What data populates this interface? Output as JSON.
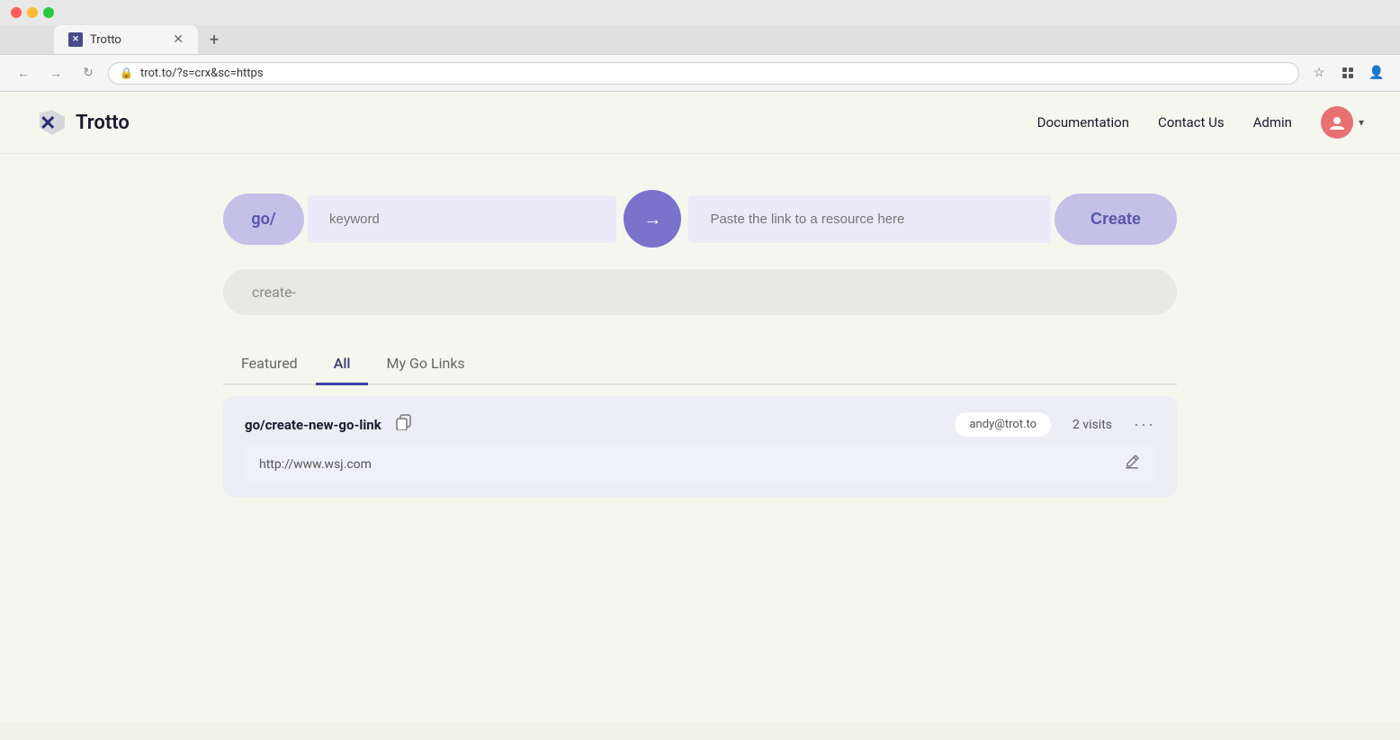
{
  "browser": {
    "tab_title": "Trotto",
    "tab_new_label": "+",
    "address": "trot.to/?s=crx&sc=https",
    "nav_back": "←",
    "nav_forward": "→",
    "nav_refresh": "↻",
    "dots": [
      "red",
      "yellow",
      "green"
    ]
  },
  "nav": {
    "logo_text": "Trotto",
    "links": [
      {
        "label": "Documentation",
        "key": "documentation"
      },
      {
        "label": "Contact Us",
        "key": "contact-us"
      },
      {
        "label": "Admin",
        "key": "admin"
      }
    ],
    "user_avatar_initials": ""
  },
  "create_bar": {
    "go_prefix": "go/",
    "keyword_placeholder": "keyword",
    "arrow": "→",
    "url_placeholder": "Paste the link to a resource here",
    "create_label": "Create"
  },
  "suggestion_bar": {
    "text": "create-"
  },
  "tabs": [
    {
      "label": "Featured",
      "key": "featured",
      "active": false
    },
    {
      "label": "All",
      "key": "all",
      "active": true
    },
    {
      "label": "My Go Links",
      "key": "my-go-links",
      "active": false
    }
  ],
  "links": [
    {
      "name": "go/create-new-go-link",
      "url": "http://www.wsj.com",
      "owner": "andy@trot.to",
      "visits": "2 visits"
    }
  ]
}
